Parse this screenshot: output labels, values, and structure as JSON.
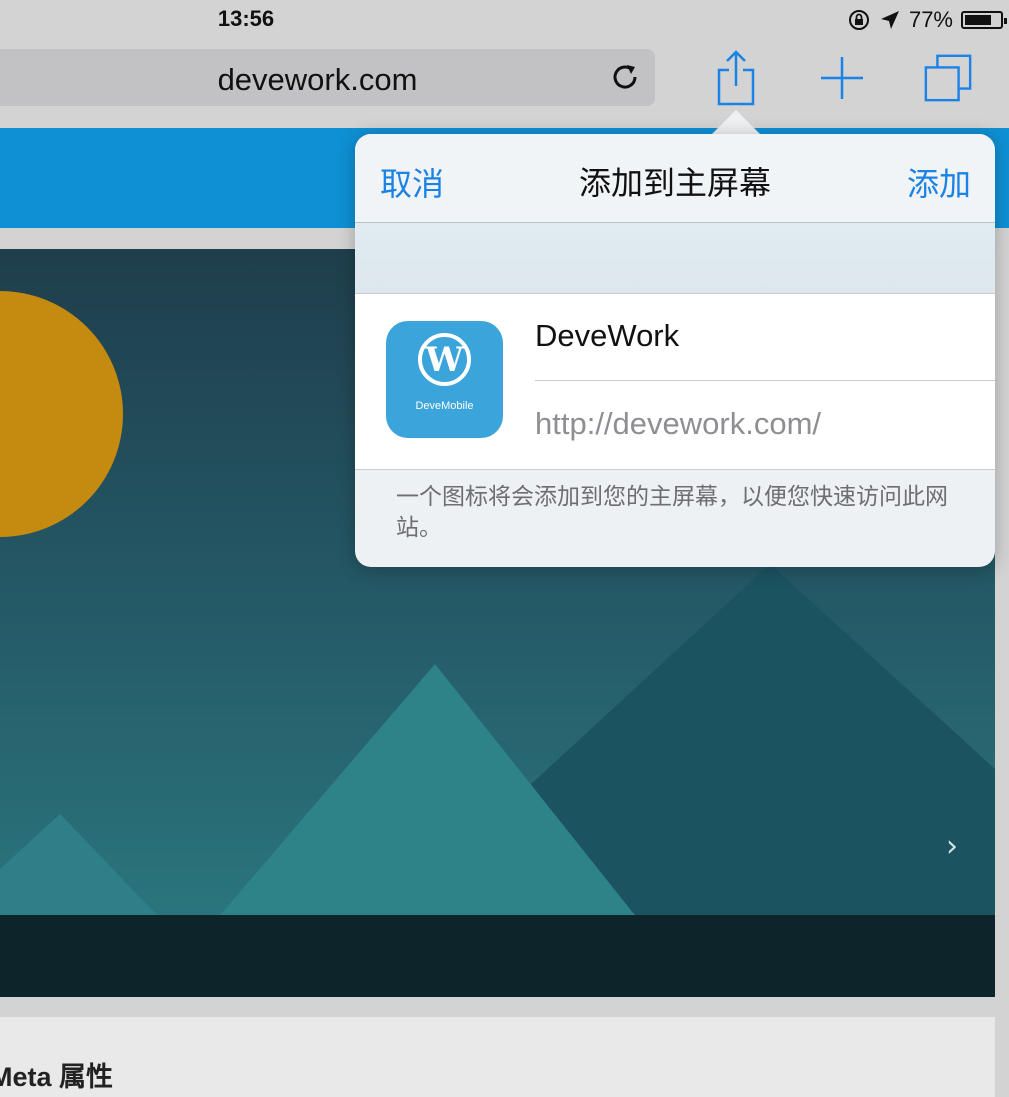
{
  "status_bar": {
    "time": "13:56",
    "battery_percent": "77%",
    "battery_level": 0.77,
    "icons": [
      "rotation-lock-icon",
      "location-arrow-icon",
      "battery-icon"
    ]
  },
  "toolbar": {
    "url": "devework.com",
    "buttons": [
      "reload-icon",
      "share-icon",
      "add-tab-icon",
      "tabs-icon"
    ]
  },
  "page": {
    "heading_fragment": "Meta 属性"
  },
  "popover": {
    "cancel_label": "取消",
    "title": "添加到主屏幕",
    "add_label": "添加",
    "app_icon_label": "DeveMobile",
    "app_icon_glyph": "W",
    "name_value": "DeveWork",
    "url_value": "http://devework.com/",
    "footer_text": "一个图标将会添加到您的主屏幕，以便您快速访问此网站。"
  },
  "colors": {
    "accent": "#1b82e6",
    "header_blue": "#0f90d4",
    "app_icon_bg": "#3aa4db"
  }
}
